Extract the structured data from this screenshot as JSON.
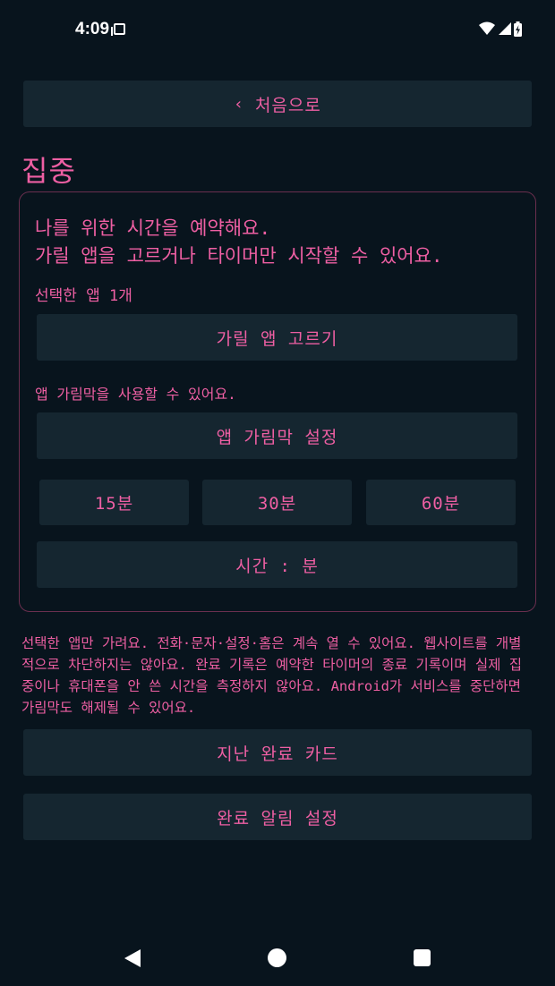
{
  "status_bar": {
    "time": "4:09"
  },
  "back_button": {
    "chevron": "‹",
    "label": "처음으로"
  },
  "page_title": "집중",
  "card": {
    "heading_line1": "나를 위한 시간을 예약해요.",
    "heading_line2": "가릴 앱을 고르거나 타이머만 시작할 수 있어요.",
    "selected_count": "선택한 앱 1개",
    "pick_apps_label": "가릴 앱 고르기",
    "overlay_note": "앱 가림막을 사용할 수 있어요.",
    "overlay_settings_label": "앱 가림막 설정",
    "durations": [
      "15분",
      "30분",
      "60분"
    ],
    "time_input_label": "시간 : 분"
  },
  "disclaimer": "선택한 앱만 가려요. 전화·문자·설정·홈은 계속 열 수 있어요. 웹사이트를 개별적으로 차단하지는 않아요. 완료 기록은 예약한 타이머의 종료 기록이며 실제 집중이나 휴대폰을 안 쓴 시간을 측정하지 않아요. Android가 서비스를 중단하면 가림막도 해제될 수 있어요.",
  "history_button_label": "지난 완료 카드",
  "alarm_button_label": "완료 알림 설정",
  "colors": {
    "background": "#08141d",
    "button": "#152630",
    "accent": "#ee5fa3",
    "card_border": "#6a2f4e"
  },
  "icons": {
    "status": [
      "sim-card-icon",
      "wifi-icon",
      "cell-signal-icon",
      "battery-charging-icon"
    ],
    "nav": [
      "nav-back-icon",
      "nav-home-icon",
      "nav-recents-icon"
    ]
  }
}
